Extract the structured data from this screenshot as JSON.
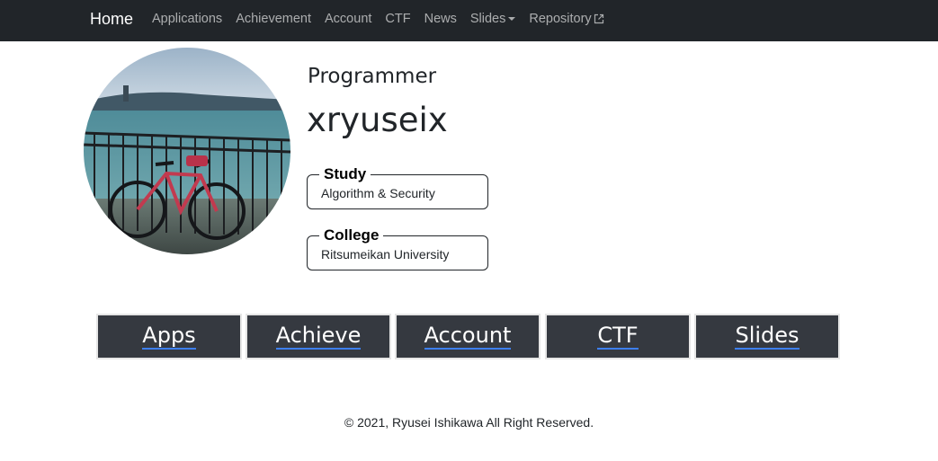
{
  "navbar": {
    "brand": "Home",
    "links": [
      {
        "label": "Applications"
      },
      {
        "label": "Achievement"
      },
      {
        "label": "Account"
      },
      {
        "label": "CTF"
      },
      {
        "label": "News"
      },
      {
        "label": "Slides",
        "icon": "caret-down-icon"
      },
      {
        "label": "Repository",
        "icon": "external-link-icon"
      }
    ]
  },
  "profile": {
    "role": "Programmer",
    "username": "xryuseix",
    "study": {
      "legend": "Study",
      "value": "Algorithm & Security"
    },
    "college": {
      "legend": "College",
      "value": "Ritsumeikan University"
    }
  },
  "buttons": [
    {
      "label": "Apps"
    },
    {
      "label": "Achieve"
    },
    {
      "label": "Account"
    },
    {
      "label": "CTF"
    },
    {
      "label": "Slides"
    }
  ],
  "footer": {
    "text": "© 2021, Ryusei Ishikawa All Right Reserved."
  },
  "colors": {
    "navbar": "#212529",
    "button_bg": "#353940",
    "link_underline": "#3d7ff5"
  }
}
